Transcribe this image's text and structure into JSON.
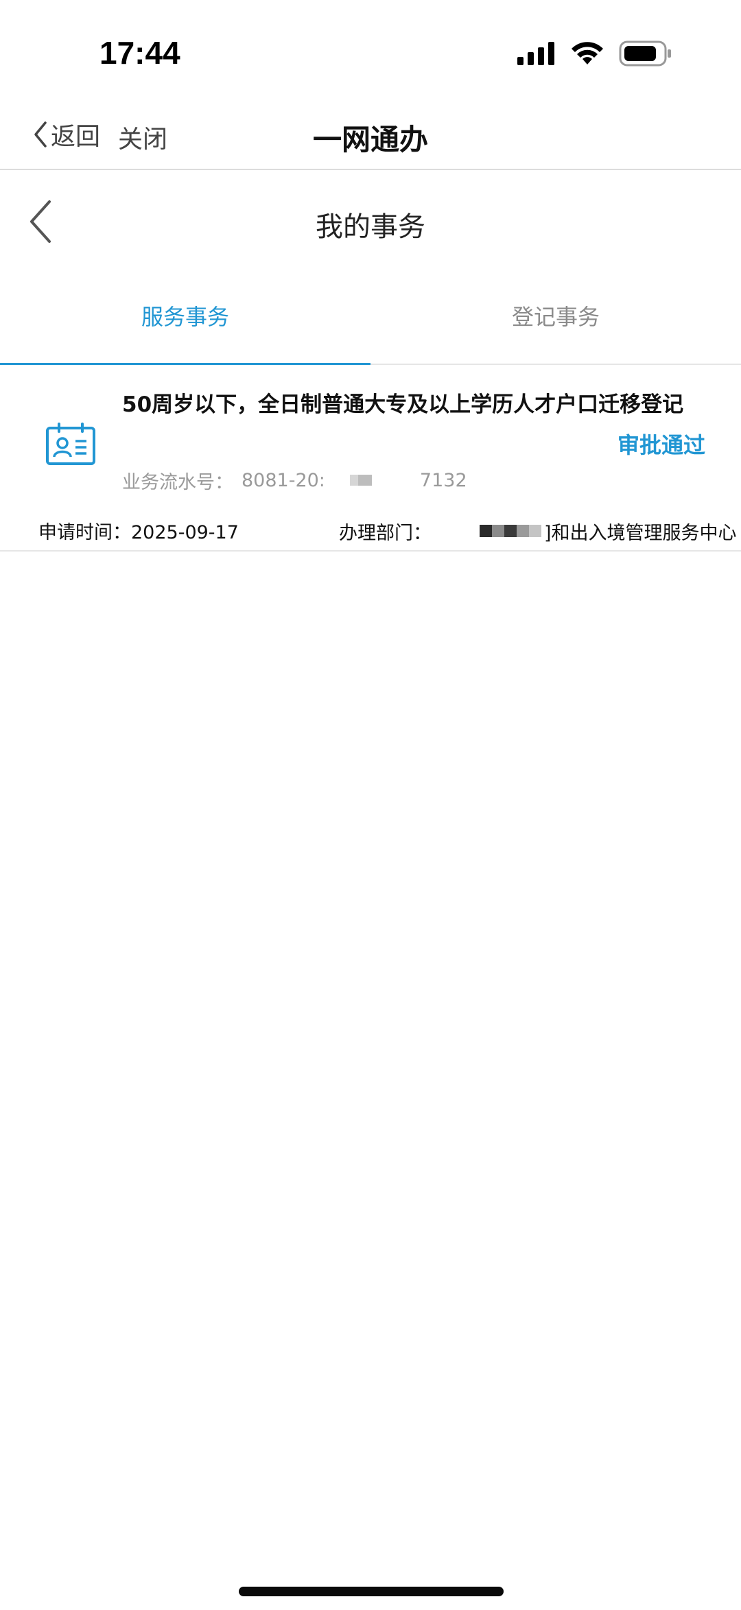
{
  "status_bar": {
    "time": "17:44",
    "icons": [
      "cellular-signal-icon",
      "wifi-icon",
      "battery-icon"
    ]
  },
  "navbar": {
    "back_label": "返回",
    "close_label": "关闭",
    "title": "一网通办"
  },
  "page": {
    "title": "我的事务"
  },
  "tabs": [
    {
      "label": "服务事务",
      "active": true
    },
    {
      "label": "登记事务",
      "active": false
    }
  ],
  "card": {
    "icon": "id-card-icon",
    "title": "50周岁以下，全日制普通大专及以上学历人才户口迁移登记",
    "status": "审批通过",
    "serial_label": "业务流水号：",
    "serial_prefix": "8081-20:",
    "serial_suffix": "7132",
    "apply_label": "申请时间：",
    "apply_date": "2025-09-17",
    "dept_label": "办理部门：",
    "dept_value": "]和出入境管理服务中心"
  },
  "colors": {
    "accent": "#2196d3",
    "muted": "#9a9a9a",
    "divider": "#e6e6e6"
  }
}
